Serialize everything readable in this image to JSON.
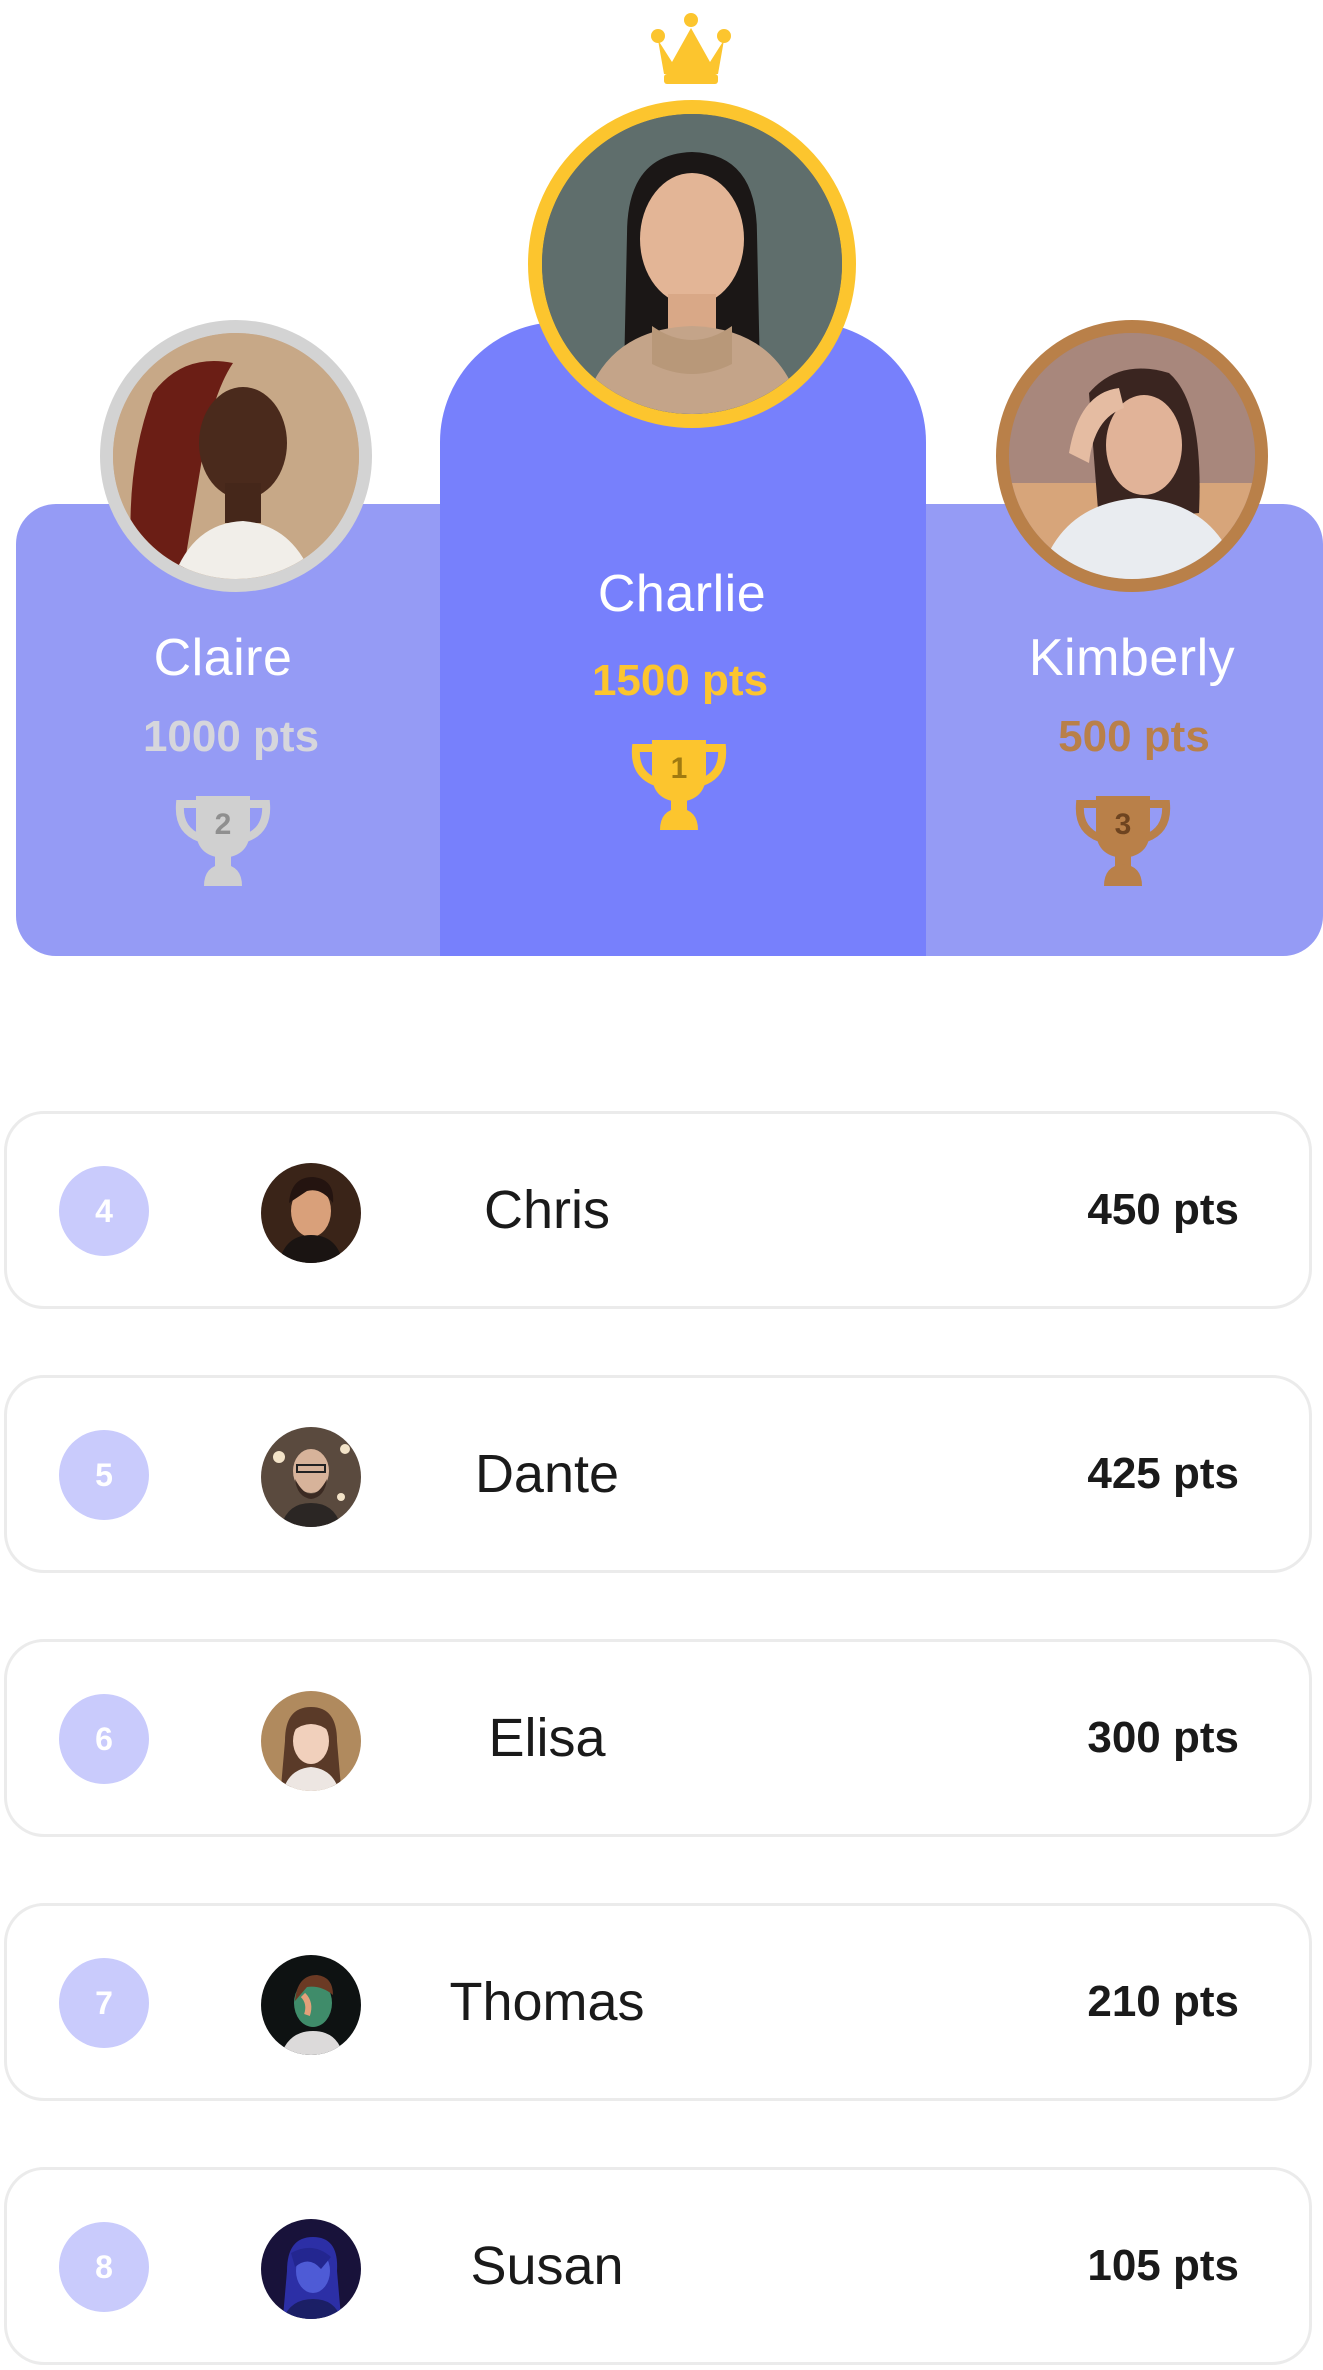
{
  "colors": {
    "podium_center": "#7780FC",
    "podium_side": "#959BF5",
    "gold": "#FCC52E",
    "silver": "#D3D3D3",
    "bronze": "#B98049",
    "rank_badge": "#C9CBFC"
  },
  "podium": {
    "first": {
      "name": "Charlie",
      "points": "1500 pts",
      "rank": "1",
      "icon": "trophy-icon",
      "crown_icon": "crown-icon"
    },
    "second": {
      "name": "Claire",
      "points": "1000 pts",
      "rank": "2",
      "icon": "trophy-icon"
    },
    "third": {
      "name": "Kimberly",
      "points": "500 pts",
      "rank": "3",
      "icon": "trophy-icon"
    }
  },
  "leaderboard": [
    {
      "rank": "4",
      "name": "Chris",
      "points": "450 pts"
    },
    {
      "rank": "5",
      "name": "Dante",
      "points": "425 pts"
    },
    {
      "rank": "6",
      "name": "Elisa",
      "points": "300 pts"
    },
    {
      "rank": "7",
      "name": "Thomas",
      "points": "210 pts"
    },
    {
      "rank": "8",
      "name": "Susan",
      "points": "105 pts"
    }
  ]
}
